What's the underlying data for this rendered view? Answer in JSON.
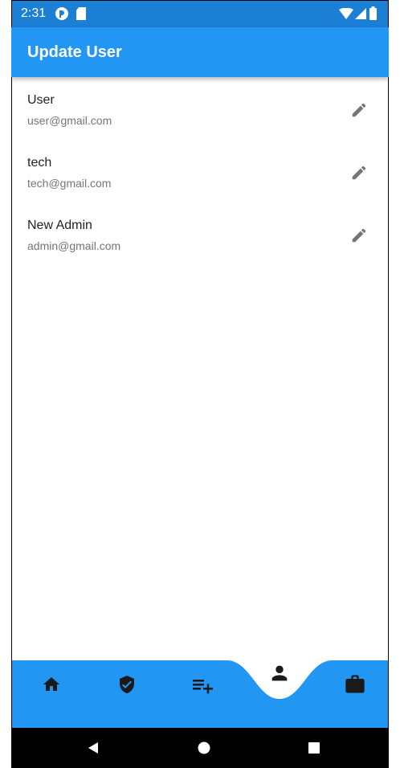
{
  "status_bar": {
    "time": "2:31",
    "icons": [
      "notification-app-icon",
      "sd-card-icon",
      "wifi-icon",
      "signal-icon",
      "battery-icon"
    ]
  },
  "app_bar": {
    "title": "Update User"
  },
  "users": [
    {
      "name": "User",
      "email": "user@gmail.com",
      "action_icon": "edit-icon"
    },
    {
      "name": "tech",
      "email": "tech@gmail.com",
      "action_icon": "edit-icon"
    },
    {
      "name": "New Admin",
      "email": "admin@gmail.com",
      "action_icon": "edit-icon"
    }
  ],
  "bottom_nav": {
    "items": [
      {
        "icon": "home-icon",
        "selected": false
      },
      {
        "icon": "shield-check-icon",
        "selected": false
      },
      {
        "icon": "playlist-add-icon",
        "selected": false
      },
      {
        "icon": "person-icon",
        "selected": true
      },
      {
        "icon": "briefcase-icon",
        "selected": false
      }
    ]
  },
  "android_nav": {
    "buttons": [
      "back-icon",
      "home-circle-icon",
      "recents-icon"
    ]
  },
  "colors": {
    "primary": "#2196f3",
    "status_bar": "#1b7fd6",
    "icon_dark": "#1a1a1a",
    "edit_icon": "#757575",
    "text_primary": "#222222",
    "text_secondary": "#757575"
  }
}
